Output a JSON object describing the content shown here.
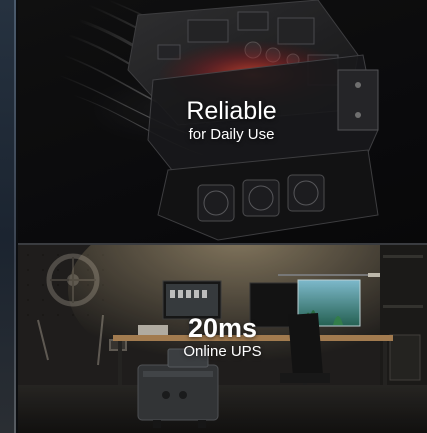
{
  "panels": [
    {
      "title": "Reliable",
      "subtitle": "for Daily Use"
    },
    {
      "title": "20ms",
      "subtitle": "Online UPS"
    }
  ],
  "colors": {
    "background": "#0b0d10",
    "text": "#ffffff",
    "heat_glow": "#e0463a",
    "cool_glow": "#4a7fe0"
  }
}
